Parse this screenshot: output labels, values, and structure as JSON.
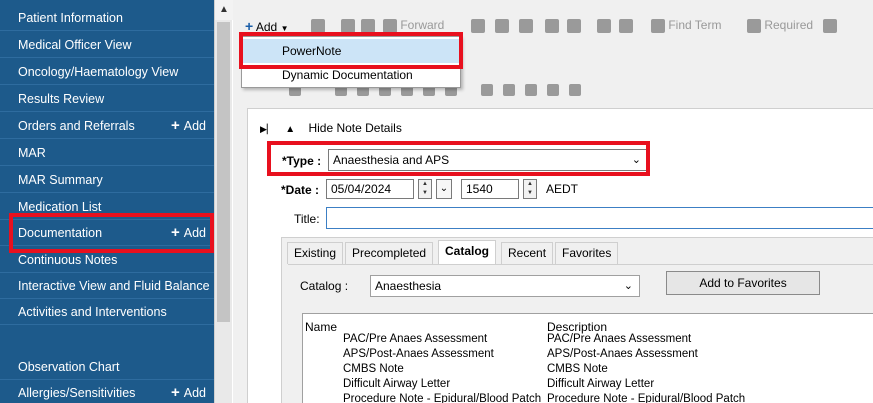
{
  "sidebar": {
    "items": [
      {
        "label": "Patient Information"
      },
      {
        "label": "Medical Officer View"
      },
      {
        "label": "Oncology/Haematology View"
      },
      {
        "label": "Results Review"
      },
      {
        "label": "Orders and Referrals",
        "add": "Add"
      },
      {
        "label": "MAR"
      },
      {
        "label": "MAR Summary"
      },
      {
        "label": "Medication List"
      },
      {
        "label": "Documentation",
        "add": "Add"
      },
      {
        "label": "Continuous Notes"
      },
      {
        "label": "Interactive View and Fluid Balance"
      },
      {
        "label": "Activities and Interventions"
      },
      {
        "label": "Observation Chart"
      },
      {
        "label": "Allergies/Sensitivities",
        "add": "Add"
      }
    ],
    "add_glyph": "+"
  },
  "toolbar": {
    "add_label": "Add",
    "forward_label": "Forward",
    "find_term_label": "Find Term",
    "required_label": "Required"
  },
  "add_menu": {
    "items": [
      "PowerNote",
      "Dynamic Documentation"
    ]
  },
  "note": {
    "hide_details": "Hide Note Details",
    "type_label": "*Type :",
    "type_value": "Anaesthesia and APS",
    "date_label": "*Date :",
    "date_value": "05/04/2024",
    "time_value": "1540",
    "timezone": "AEDT",
    "title_label": "Title:",
    "title_value": ""
  },
  "tabs": [
    {
      "label": "Existing"
    },
    {
      "label": "Precompleted"
    },
    {
      "label": "Catalog",
      "active": true
    },
    {
      "label": "Recent"
    },
    {
      "label": "Favorites"
    }
  ],
  "catalog": {
    "label": "Catalog :",
    "selected": "Anaesthesia",
    "add_favorites": "Add to Favorites",
    "columns": [
      "Name",
      "Description"
    ],
    "rows": [
      {
        "name": "PAC/Pre Anaes  Assessment",
        "description": "PAC/Pre Anaes  Assessment"
      },
      {
        "name": "APS/Post-Anaes Assessment",
        "description": "APS/Post-Anaes Assessment"
      },
      {
        "name": "CMBS Note",
        "description": "CMBS Note"
      },
      {
        "name": "Difficult Airway Letter",
        "description": "Difficult Airway Letter"
      },
      {
        "name": "Procedure Note - Epidural/Blood Patch",
        "description": "Procedure Note - Epidural/Blood Patch"
      }
    ]
  },
  "colors": {
    "sidebar_bg": "#1d5a8b",
    "highlight": "#e8101e",
    "menu_selected": "#cce4f7"
  }
}
